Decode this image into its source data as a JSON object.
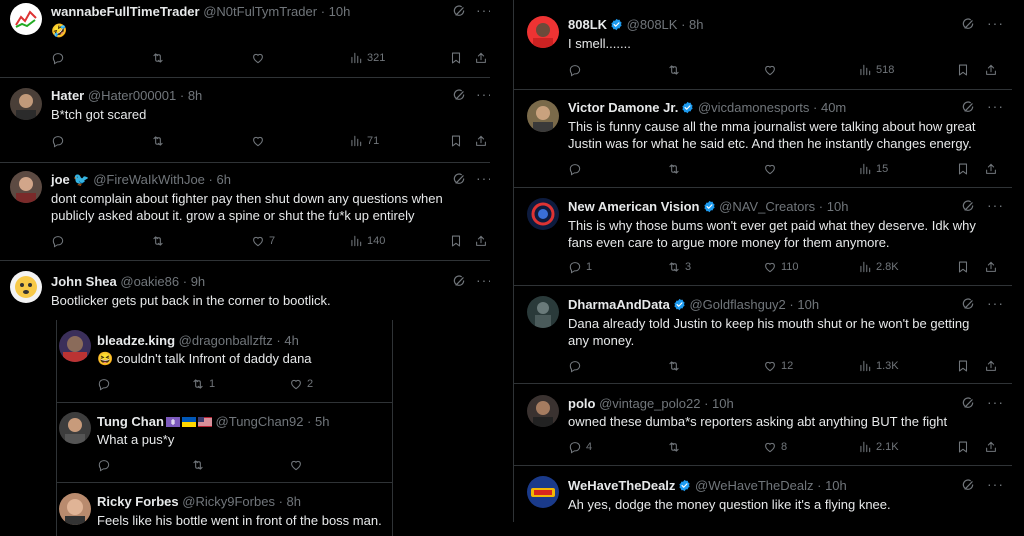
{
  "left": {
    "t1": {
      "name": "wannabeFullTimeTrader",
      "handle": "@N0tFulTymTrader",
      "time": "10h",
      "text": "🤣",
      "views": "321"
    },
    "t2": {
      "name": "Hater",
      "handle": "@Hater000001",
      "time": "8h",
      "text": "B*tch got scared",
      "views": "71"
    },
    "t3": {
      "name": "joe",
      "handle": "@FireWaIkWithJoe",
      "time": "6h",
      "text": "dont complain about fighter pay then shut down any questions when publicly asked about it. grow a spine or shut the fu*k up entirely",
      "likes": "7",
      "views": "140"
    },
    "t4": {
      "name": "John Shea",
      "handle": "@oakie86",
      "time": "9h",
      "text": "Bootlicker gets put back in the corner to bootlick."
    },
    "r1": {
      "name": "bleadze.king",
      "handle": "@dragonballzftz",
      "time": "4h",
      "text": "😆 couldn't talk Infront of daddy dana",
      "retweets": "1",
      "likes": "2"
    },
    "r2": {
      "name": "Tung Chan",
      "handle": "@TungChan92",
      "time": "5h",
      "text": "What a pus*y"
    },
    "r3": {
      "name": "Ricky Forbes",
      "handle": "@Ricky9Forbes",
      "time": "8h",
      "text": "Feels like his bottle went in front of the boss man."
    }
  },
  "right": {
    "t1": {
      "name": "808LK",
      "handle": "@808LK",
      "time": "8h",
      "text": "I smell.......",
      "views": "518"
    },
    "t2": {
      "name": "Victor Damone Jr.",
      "handle": "@vicdamonesports",
      "time": "40m",
      "text": "This is funny cause all the mma journalist were talking about how great Justin was for what he said etc. And then he instantly changes energy.",
      "views": "15"
    },
    "t3": {
      "name": "New American Vision",
      "handle": "@NAV_Creators",
      "time": "10h",
      "text": "This is why those bums won't ever get paid what they deserve. Idk why fans even care to argue more money for them anymore.",
      "replies": "1",
      "retweets": "3",
      "likes": "110",
      "views": "2.8K"
    },
    "t4": {
      "name": "DharmaAndData",
      "handle": "@Goldflashguy2",
      "time": "10h",
      "text": "Dana already told Justin to keep his mouth shut or he won't be getting any money.",
      "likes": "12",
      "views": "1.3K"
    },
    "t5": {
      "name": "polo",
      "handle": "@vintage_polo22",
      "time": "10h",
      "text": "owned these dumba*s reporters asking abt anything BUT the fight",
      "replies": "4",
      "likes": "8",
      "views": "2.1K"
    },
    "t6": {
      "name": "WeHaveTheDealz",
      "handle": "@WeHaveTheDealz",
      "time": "10h",
      "text": "Ah yes, dodge the money question like it's a flying knee."
    }
  },
  "icons": {
    "more": "···",
    "sep": " · "
  },
  "colors": {
    "bg": "#000000",
    "text": "#e7e9ea",
    "muted": "#71767b",
    "verified": "#1d9bf0",
    "divider": "#2f3336"
  }
}
